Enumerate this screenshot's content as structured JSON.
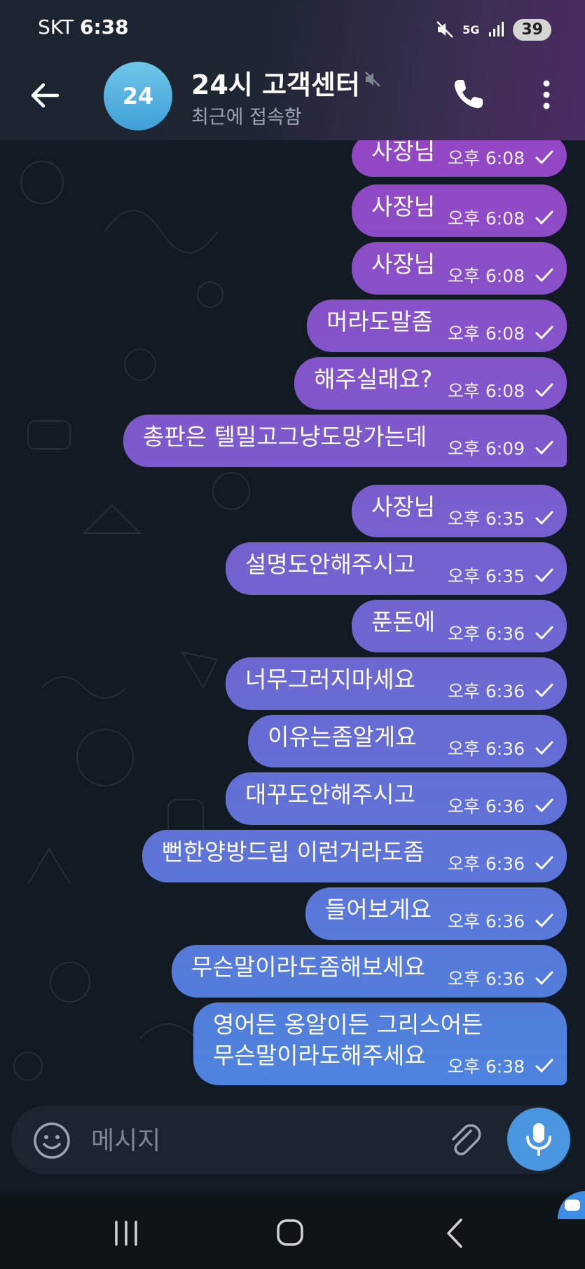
{
  "status_bar": {
    "carrier": "SKT",
    "time": "6:38",
    "network": "5G",
    "battery": "39"
  },
  "header": {
    "avatar_text": "24",
    "title": "24시 고객센터",
    "subtitle": "최근에 접속함"
  },
  "messages": [
    {
      "text": "사장님",
      "time": "오후 6:08"
    },
    {
      "text": "사장님",
      "time": "오후 6:08"
    },
    {
      "text": "사장님",
      "time": "오후 6:08"
    },
    {
      "text": "머라도말좀",
      "time": "오후 6:08"
    },
    {
      "text": "해주실래요?",
      "time": "오후 6:08"
    },
    {
      "text": "총판은 텔밀고그냥도망가는데",
      "time": "오후 6:09"
    },
    {
      "text": "사장님",
      "time": "오후 6:35"
    },
    {
      "text": "설명도안해주시고",
      "time": "오후 6:35"
    },
    {
      "text": "푼돈에",
      "time": "오후 6:36"
    },
    {
      "text": "너무그러지마세요",
      "time": "오후 6:36"
    },
    {
      "text": "이유는좀알게요",
      "time": "오후 6:36"
    },
    {
      "text": "대꾸도안해주시고",
      "time": "오후 6:36"
    },
    {
      "text": "뻔한양방드립 이런거라도좀",
      "time": "오후 6:36"
    },
    {
      "text": "들어보게요",
      "time": "오후 6:36"
    },
    {
      "text": "무슨말이라도좀해보세요",
      "time": "오후 6:36"
    },
    {
      "text": "영어든 옹알이든 그리스어든\n무슨말이라도해주세요",
      "time": "오후 6:38"
    }
  ],
  "composer": {
    "placeholder": "메시지"
  },
  "colors": {
    "bubble_top": "#9446c4",
    "bubble_bottom": "#4b84de",
    "header_accent": "#4b2c64",
    "mic_button": "#4a96e0"
  },
  "icons": [
    "back-arrow-icon",
    "mute-icon",
    "phone-icon",
    "more-vert-icon",
    "check-icon",
    "emoji-icon",
    "paperclip-icon",
    "microphone-icon",
    "recent-apps-icon",
    "home-icon",
    "nav-back-icon"
  ]
}
